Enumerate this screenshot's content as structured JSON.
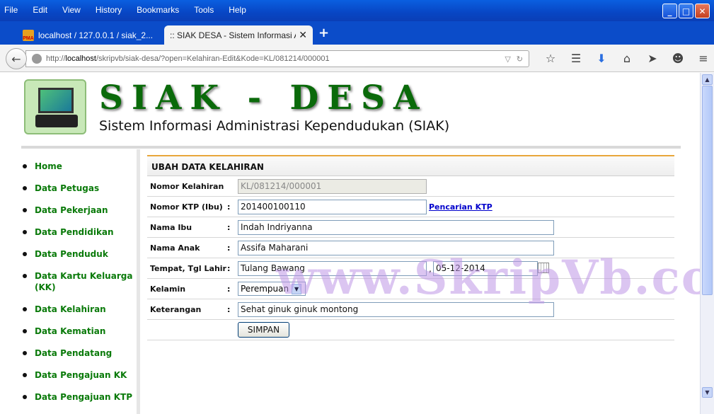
{
  "browser": {
    "menu": [
      "File",
      "Edit",
      "View",
      "History",
      "Bookmarks",
      "Tools",
      "Help"
    ],
    "window_buttons": {
      "minimize": "_",
      "maximize": "□",
      "close": "✕"
    },
    "tabs": [
      {
        "title": "localhost / 127.0.0.1 / siak_2...",
        "favicon": "PMA"
      },
      {
        "title": ":: SIAK DESA - Sistem Informasi A...",
        "close": "✕"
      }
    ],
    "new_tab": "+",
    "url_prefix": "http://",
    "url_host": "localhost",
    "url_path": "/skripvb/siak-desa/?open=Kelahiran-Edit&Kode=KL/081214/000001",
    "icons": [
      "star-icon",
      "reading-list-icon",
      "download-icon",
      "home-icon",
      "send-icon",
      "hello-icon",
      "menu-icon"
    ]
  },
  "site": {
    "title": "SIAK - DESA",
    "subtitle": "Sistem Informasi Administrasi Kependudukan (SIAK)"
  },
  "sidebar": {
    "items": [
      {
        "label": "Home"
      },
      {
        "label": "Data Petugas"
      },
      {
        "label": "Data Pekerjaan"
      },
      {
        "label": "Data Pendidikan"
      },
      {
        "label": "Data Penduduk"
      },
      {
        "label": "Data Kartu Keluarga (KK)"
      },
      {
        "label": "Data Kelahiran"
      },
      {
        "label": "Data Kematian"
      },
      {
        "label": "Data Pendatang"
      },
      {
        "label": "Data Pengajuan KK"
      },
      {
        "label": "Data Pengajuan KTP"
      }
    ]
  },
  "form": {
    "title": "UBAH DATA KELAHIRAN",
    "colon": ":",
    "fields": {
      "nomor_kelahiran": {
        "label": "Nomor Kelahiran",
        "value": "KL/081214/000001"
      },
      "nomor_ktp": {
        "label": "Nomor KTP (Ibu)",
        "value": "201400100110",
        "link": "Pencarian KTP"
      },
      "nama_ibu": {
        "label": "Nama Ibu",
        "value": "Indah Indriyanna"
      },
      "nama_anak": {
        "label": "Nama Anak",
        "value": "Assifa Maharani"
      },
      "tempat_tgl_lahir": {
        "label": "Tempat, Tgl Lahir",
        "tempat": "Tulang Bawang",
        "separator": ",",
        "tanggal": "05-12-2014"
      },
      "kelamin": {
        "label": "Kelamin",
        "value": "Perempuan"
      },
      "keterangan": {
        "label": "Keterangan",
        "value": "Sehat ginuk ginuk montong"
      }
    },
    "submit_label": "SIMPAN"
  },
  "watermark": "www.SkripVb.com"
}
